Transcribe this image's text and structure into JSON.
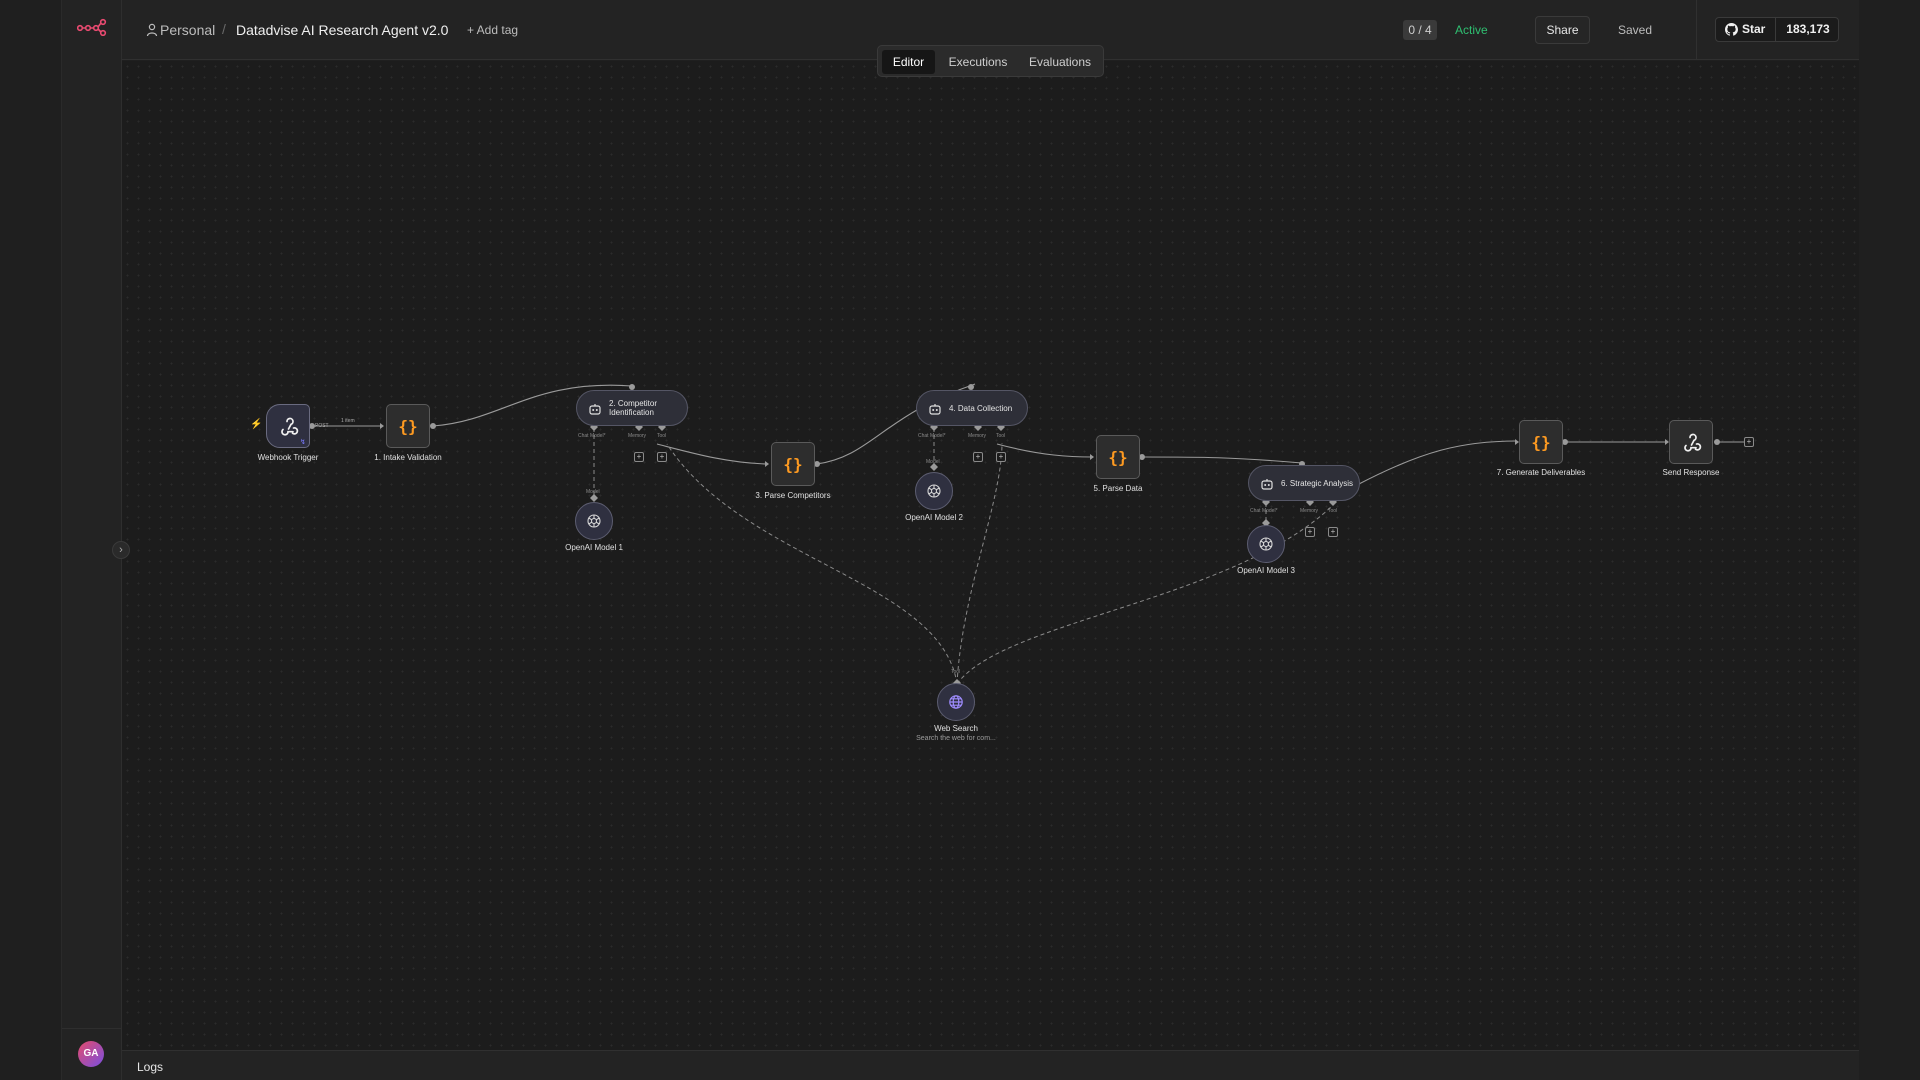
{
  "header": {
    "project": "Personal",
    "workflow_title": "Datadvise AI Research Agent v2.0",
    "add_tag": "+ Add tag",
    "counter": "0 / 4",
    "status": "Active",
    "share": "Share",
    "saved": "Saved",
    "github_star": "Star",
    "github_count": "183,173"
  },
  "tabs": [
    "Editor",
    "Executions",
    "Evaluations"
  ],
  "active_tab": "Editor",
  "avatar_initials": "GA",
  "logs_label": "Logs",
  "colors": {
    "accent": "#ff6d5a",
    "code": "#ff9b21",
    "active": "#2fbf71",
    "edge": "#9a9a9a"
  },
  "nodes": {
    "webhook_trigger": "Webhook Trigger",
    "intake_validation": "1. Intake Validation",
    "competitor_identification_l1": "2. Competitor",
    "competitor_identification_l2": "Identification",
    "openai_model_1": "OpenAI Model 1",
    "parse_competitors": "3. Parse Competitors",
    "data_collection": "4. Data Collection",
    "openai_model_2": "OpenAI Model 2",
    "parse_data": "5. Parse Data",
    "strategic_analysis": "6. Strategic Analysis",
    "openai_model_3": "OpenAI Model 3",
    "generate_deliverables": "7. Generate Deliverables",
    "send_response": "Send Response",
    "web_search": "Web Search",
    "web_search_sub": "Search the web for com..."
  },
  "ports": {
    "chat_model": "Chat Model*",
    "memory": "Memory",
    "tool": "Tool",
    "model": "Model"
  },
  "edge_labels": {
    "item_count": "1 item",
    "post": "POST"
  },
  "icons": [
    "logo-icon",
    "user-icon",
    "github-icon",
    "webhook-icon",
    "code-icon",
    "robot-icon",
    "openai-icon",
    "globe-icon",
    "chevron-right-icon",
    "lightning-icon",
    "plus-icon"
  ]
}
